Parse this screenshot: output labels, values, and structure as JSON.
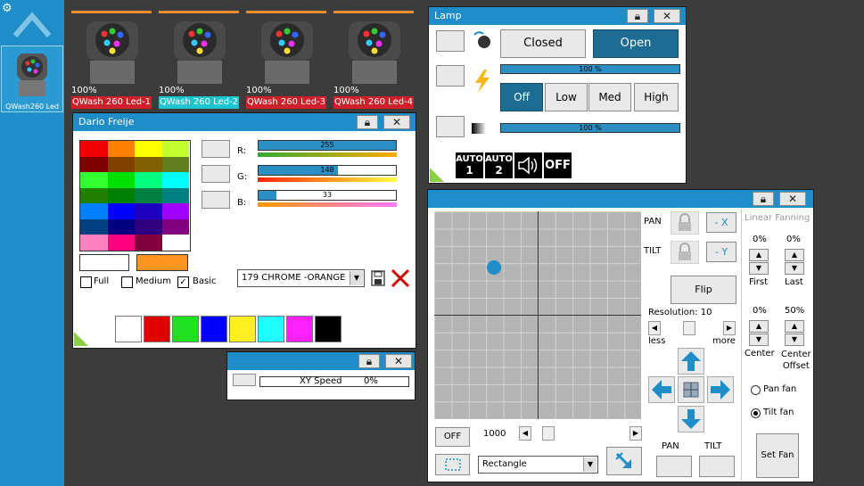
{
  "sidebar": {
    "item_label": "QWash260 Led"
  },
  "fixtures": [
    {
      "pct": "100%",
      "name": "QWash 260 Led-1",
      "style": "red"
    },
    {
      "pct": "100%",
      "name": "QWash 260 Led-2",
      "style": "cyan"
    },
    {
      "pct": "100%",
      "name": "QWash 260 Led-3",
      "style": "red"
    },
    {
      "pct": "100%",
      "name": "QWash 260 Led-4",
      "style": "red"
    }
  ],
  "lamp": {
    "title": "Lamp",
    "closed_label": "Closed",
    "open_label": "Open",
    "bar1_text": "100 %",
    "bar1_fraction": 1.0,
    "off_label": "Off",
    "low_label": "Low",
    "med_label": "Med",
    "high_label": "High",
    "bar2_text": "100 %",
    "bar2_fraction": 1.0,
    "auto1_top": "AUTO",
    "auto1_bottom": "1",
    "auto2_top": "AUTO",
    "auto2_bottom": "2",
    "off_icon_label": "OFF"
  },
  "color": {
    "title": "Dario Freije",
    "r_label": "R:",
    "g_label": "G:",
    "b_label": "B:",
    "r_value": "255",
    "g_value": "148",
    "b_value": "33",
    "r_fraction": 1.0,
    "g_fraction": 0.58,
    "b_fraction": 0.13,
    "palette": [
      "#f00000",
      "#ff8000",
      "#ffff00",
      "#c0ff30",
      "#800000",
      "#804000",
      "#806000",
      "#608020",
      "#30ff30",
      "#00e000",
      "#00ff80",
      "#00ffff",
      "#208000",
      "#008000",
      "#008040",
      "#008080",
      "#0080ff",
      "#0000ff",
      "#2000c0",
      "#a000ff",
      "#004080",
      "#000080",
      "#300080",
      "#800080",
      "#ff80c0",
      "#ff0080",
      "#800040",
      "#ffffff"
    ],
    "current_color": "#ffffff",
    "target_color": "#ff9421",
    "full_label": "Full",
    "medium_label": "Medium",
    "basic_label": "Basic",
    "full_checked": false,
    "medium_checked": false,
    "basic_checked": true,
    "gel_value": "179 CHROME -ORANGE",
    "swatches": [
      "#ffffff",
      "#e00000",
      "#20e020",
      "#0000ff",
      "#ffee20",
      "#20ffff",
      "#ff20ff",
      "#000000"
    ]
  },
  "speed": {
    "label": "XY Speed",
    "value": "0%"
  },
  "pantilt": {
    "pan_label": "PAN",
    "tilt_label": "TILT",
    "minus_x": "- X",
    "minus_y": "- Y",
    "flip_label": "Flip",
    "resolution_label": "Resolution: 10",
    "less_label": "less",
    "more_label": "more",
    "off_label": "OFF",
    "speed_value": "1000",
    "shape_value": "Rectangle",
    "pan_bottom": "PAN",
    "tilt_bottom": "TILT",
    "linear_fanning": "Linear Fanning",
    "first_pct": "0%",
    "last_pct": "0%",
    "first_label": "First",
    "last_label": "Last",
    "center_pct": "0%",
    "offset_pct": "50%",
    "center_label": "Center",
    "center_offset_label": "Center\nOffset",
    "pan_fan_label": "Pan fan",
    "tilt_fan_label": "Tilt fan",
    "pan_fan_checked": false,
    "tilt_fan_checked": true,
    "set_fan_label": "Set Fan",
    "dot_x": 0.5,
    "dot_y": 0.5
  },
  "colors": {
    "accent": "#1f8ec8",
    "dark_blue_button": "#1c6c93",
    "orange_bar": "#e88a2e",
    "red_label": "#d11f2a",
    "cyan_label": "#1bc6d1"
  }
}
